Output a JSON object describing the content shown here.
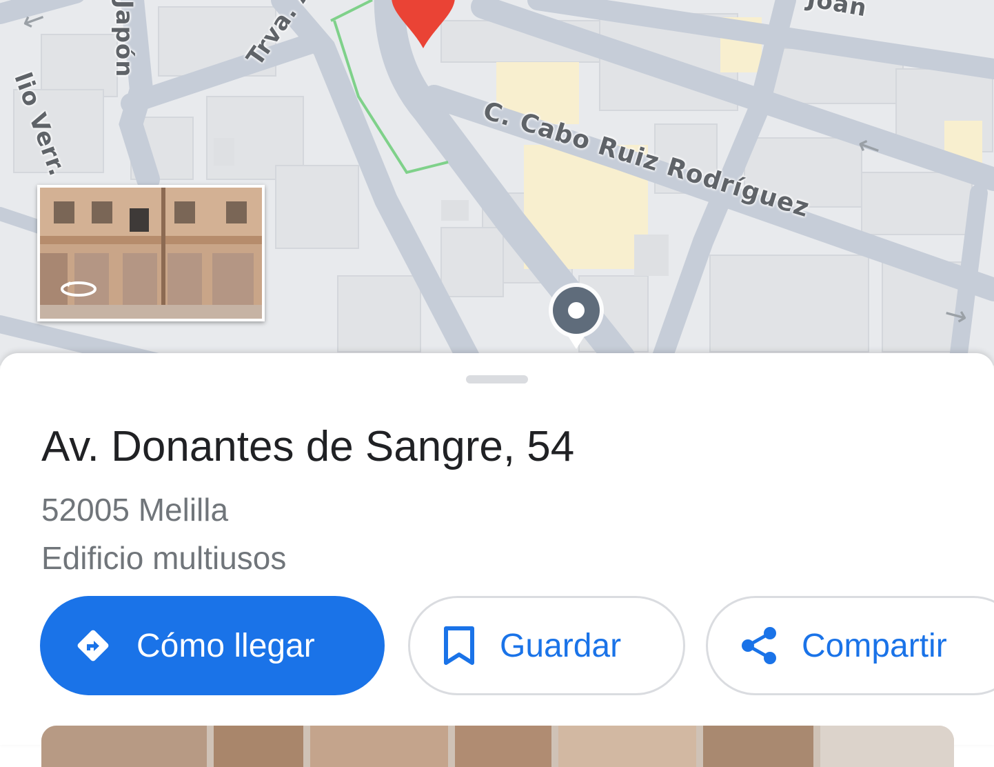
{
  "map": {
    "street_labels": {
      "cabo_ruiz": "C. Cabo Ruiz Rodríguez",
      "travesia": "Trva. A",
      "joan": "Joan",
      "japon": "Japón",
      "verr": "lio Verr."
    }
  },
  "place": {
    "title": "Av. Donantes de Sangre, 54",
    "address": "52005 Melilla",
    "category": "Edificio multiusos"
  },
  "actions": {
    "directions": "Cómo llegar",
    "save": "Guardar",
    "share": "Compartir"
  },
  "colors": {
    "accent": "#1a73e8",
    "map_background": "#e8eaed",
    "road": "#c6cdd8",
    "pin_red": "#ea4335",
    "pin_gray": "#5f6c7b"
  },
  "icons": {
    "directions": "directions-icon",
    "save": "bookmark-icon",
    "share": "share-icon",
    "street_view": "rotate-360-icon"
  }
}
